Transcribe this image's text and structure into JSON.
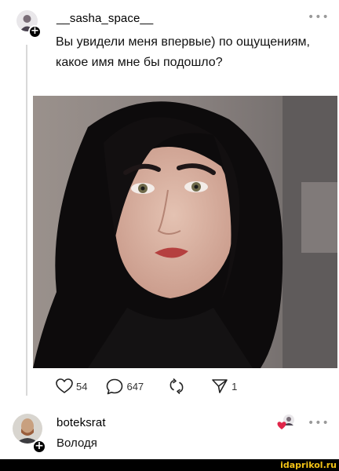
{
  "post": {
    "username": "__sasha_space__",
    "text": "Вы увидели меня впервые) по ощущениям, какое имя мне бы подошло?",
    "more_icon": "more-horizontal-icon",
    "likes": "54",
    "comments": "647",
    "reposts_label": "",
    "shares": "1"
  },
  "reply": {
    "username": "boteksrat",
    "text": "Володя",
    "more_icon": "more-horizontal-icon"
  },
  "watermark": "idaprikol.ru",
  "colors": {
    "accent_red": "#e0264a",
    "watermark_yellow": "#f3c316",
    "thread_line": "#d9d9d9"
  }
}
